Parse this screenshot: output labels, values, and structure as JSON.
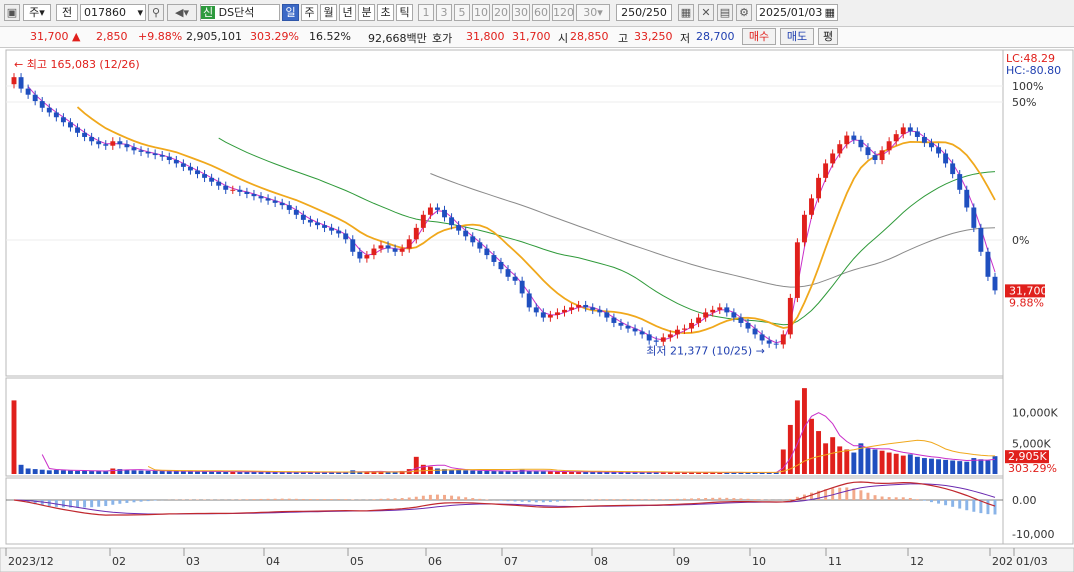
{
  "toolbar": {
    "period_label": "주",
    "ref_label": "전",
    "code": "017860",
    "stock_badge": "신",
    "stock_name": "DS단석",
    "period_tabs": [
      "일",
      "주",
      "월",
      "년",
      "분",
      "초",
      "틱"
    ],
    "active_tab": "일",
    "intervals": [
      "1",
      "3",
      "5",
      "10",
      "20",
      "30",
      "60",
      "120"
    ],
    "interval_value": "30",
    "count_value": "250",
    "count_total": "/250",
    "date_value": "2025/01/03"
  },
  "quote": {
    "price": "31,700",
    "change_arrow": "▲",
    "change": "2,850",
    "change_pct": "+9.88%",
    "volume": "2,905,101",
    "volume_ratio": "303.29%",
    "turnover": "16.52%",
    "amount": "92,668백만",
    "bid_label": "호가",
    "bid1": "31,800",
    "bid2": "31,700",
    "open_label": "시",
    "open": "28,850",
    "high_label": "고",
    "high": "33,250",
    "low_label": "저",
    "low": "28,700",
    "buy_label": "매수",
    "sell_label": "매도",
    "eval_label": "평"
  },
  "colors": {
    "up": "#e0201c",
    "down": "#1f4fbf",
    "ma5": "#c92fc9",
    "ma20": "#f0a81c",
    "ma60": "#2f9a3a",
    "ma120": "#8a8a8a",
    "ma_long": "#1b2a8a",
    "macd": "#c0282e",
    "signal": "#6a2ab0"
  },
  "chart_data": {
    "type": "candlestick",
    "price_axis_labels": [
      "100%",
      "50%",
      "0%"
    ],
    "lc": "LC:48.29",
    "hc": "HC:-80.80",
    "high_note": "최고 165,083 (12/26)",
    "low_note": "최저 21,377 (10/25)",
    "last_price_tag": "31,700",
    "last_pct_tag": "9.88%",
    "price_close": [
      150000,
      138000,
      132000,
      126000,
      120000,
      116000,
      112000,
      108000,
      104000,
      100000,
      97000,
      94000,
      92000,
      91000,
      94000,
      92000,
      90000,
      88000,
      87000,
      86000,
      85000,
      84000,
      82000,
      80000,
      78000,
      76000,
      74000,
      72000,
      70000,
      68000,
      66000,
      66000,
      65000,
      64000,
      63000,
      62000,
      61000,
      60000,
      59000,
      57000,
      55000,
      53000,
      52000,
      51000,
      50000,
      49000,
      48000,
      46000,
      42000,
      40000,
      41000,
      43000,
      44000,
      43000,
      42000,
      43000,
      46000,
      50000,
      55000,
      58000,
      57000,
      54000,
      51000,
      49000,
      47000,
      45000,
      43000,
      41000,
      39000,
      37000,
      35000,
      34000,
      31000,
      28000,
      27000,
      26000,
      26500,
      27000,
      27500,
      28000,
      28500,
      28000,
      27500,
      27000,
      26000,
      25000,
      24500,
      24000,
      23500,
      23000,
      22000,
      21800,
      22500,
      23000,
      23800,
      24000,
      25000,
      26000,
      27000,
      27500,
      28000,
      27000,
      26000,
      25000,
      24000,
      23000,
      22000,
      21500,
      21377,
      23000,
      30000,
      45000,
      55000,
      62000,
      72000,
      80000,
      86000,
      92000,
      98000,
      95000,
      90000,
      85000,
      82000,
      88000,
      94000,
      99000,
      104000,
      101000,
      97000,
      93000,
      90000,
      86000,
      80000,
      74000,
      66000,
      58000,
      50000,
      42000,
      35000,
      31700
    ],
    "volume_axis_labels": [
      "10,000K",
      "5,000K"
    ],
    "volume_tag": "2,905K",
    "volume_ratio_tag": "303.29%",
    "volume_k": [
      12000,
      1500,
      900,
      800,
      700,
      600,
      650,
      600,
      550,
      500,
      520,
      480,
      500,
      450,
      900,
      800,
      700,
      600,
      550,
      520,
      500,
      480,
      460,
      450,
      440,
      430,
      420,
      410,
      400,
      390,
      380,
      370,
      360,
      350,
      340,
      330,
      320,
      310,
      300,
      300,
      300,
      290,
      290,
      280,
      280,
      280,
      270,
      270,
      600,
      400,
      380,
      360,
      350,
      340,
      330,
      500,
      800,
      2800,
      1500,
      1200,
      900,
      800,
      700,
      650,
      600,
      550,
      520,
      500,
      480,
      460,
      450,
      430,
      700,
      500,
      450,
      420,
      400,
      380,
      370,
      360,
      350,
      340,
      330,
      320,
      310,
      300,
      300,
      290,
      290,
      280,
      280,
      270,
      270,
      270,
      260,
      260,
      260,
      250,
      250,
      250,
      250,
      250,
      250,
      250,
      250,
      250,
      250,
      250,
      260,
      4000,
      8000,
      12000,
      14000,
      9000,
      7000,
      5000,
      6000,
      4500,
      4000,
      3500,
      5000,
      4200,
      4000,
      3800,
      3500,
      3300,
      3000,
      3200,
      2800,
      2600,
      2500,
      2400,
      2300,
      2200,
      2100,
      2000,
      2600,
      2400,
      2200,
      2905
    ],
    "macd_axis_labels": [
      "0.00",
      "-10,000"
    ],
    "date_labels": [
      "2023/12",
      "02",
      "03",
      "04",
      "05",
      "06",
      "07",
      "08",
      "09",
      "10",
      "11",
      "12",
      "202",
      "01/03"
    ]
  }
}
